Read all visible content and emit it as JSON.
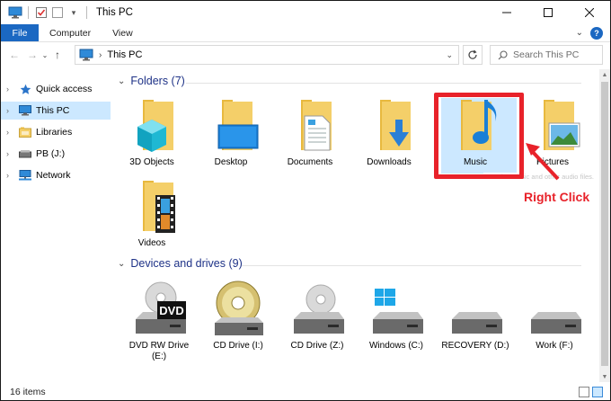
{
  "window": {
    "title": "This PC"
  },
  "ribbon": {
    "tabs": [
      "File",
      "Computer",
      "View"
    ]
  },
  "nav": {
    "address_crumb": "This PC",
    "search_placeholder": "Search This PC"
  },
  "sidebar": {
    "items": [
      {
        "label": "Quick access",
        "icon": "star-icon"
      },
      {
        "label": "This PC",
        "icon": "computer-icon",
        "selected": true
      },
      {
        "label": "Libraries",
        "icon": "libraries-icon"
      },
      {
        "label": "PB (J:)",
        "icon": "drive-icon"
      },
      {
        "label": "Network",
        "icon": "network-icon"
      }
    ]
  },
  "folders": {
    "header": "Folders (7)",
    "items": [
      {
        "label": "3D Objects",
        "icon": "3d-objects-folder-icon"
      },
      {
        "label": "Desktop",
        "icon": "desktop-folder-icon"
      },
      {
        "label": "Documents",
        "icon": "documents-folder-icon"
      },
      {
        "label": "Downloads",
        "icon": "downloads-folder-icon"
      },
      {
        "label": "Music",
        "icon": "music-folder-icon",
        "selected": true
      },
      {
        "label": "Pictures",
        "icon": "pictures-folder-icon"
      },
      {
        "label": "Videos",
        "icon": "videos-folder-icon"
      }
    ]
  },
  "devices": {
    "header": "Devices and drives (9)",
    "items": [
      {
        "label": "DVD RW Drive (E:)",
        "line1": "DVD RW Drive",
        "line2": "(E:)",
        "icon": "dvd-drive-icon",
        "badge": "DVD"
      },
      {
        "label": "CD Drive (I:)",
        "icon": "cd-drive-icon"
      },
      {
        "label": "CD Drive (Z:)",
        "icon": "cd-drive-icon"
      },
      {
        "label": "Windows (C:)",
        "icon": "windows-drive-icon"
      },
      {
        "label": "RECOVERY (D:)",
        "icon": "hard-drive-icon"
      },
      {
        "label": "Work (F:)",
        "icon": "hard-drive-icon"
      }
    ]
  },
  "tooltip": "Contains music and other audio files.",
  "annotation": {
    "callout": "Right Click"
  },
  "status": {
    "item_count": "16 items"
  },
  "colors": {
    "accent": "#1b68c2",
    "selection": "#cce8ff",
    "annotation": "#e8222a",
    "folder": "#f4cf69"
  }
}
